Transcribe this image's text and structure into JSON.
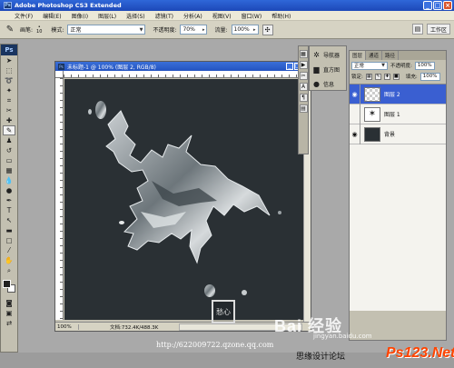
{
  "app": {
    "title": "Adobe Photoshop CS3 Extended",
    "logo": "Ps"
  },
  "menu": [
    "文件(F)",
    "编辑(E)",
    "图像(I)",
    "图层(L)",
    "选择(S)",
    "滤镜(T)",
    "分析(A)",
    "视图(V)",
    "窗口(W)",
    "帮助(H)"
  ],
  "options": {
    "brush_label": "画笔:",
    "brush_size": "10",
    "mode_label": "模式:",
    "mode_value": "正常",
    "opacity_label": "不透明度:",
    "opacity_value": "70%",
    "flow_label": "流量:",
    "flow_value": "100%",
    "workspace_label": "工作区"
  },
  "document": {
    "title": "未标题-1 @ 100% (图层 2, RGB/8)",
    "zoom": "100%",
    "doc_size": "文档:732.4K/488.3K",
    "canvas_color": "#2a3034"
  },
  "dock": {
    "items": [
      {
        "icon": "navigator-icon",
        "label": "导航器"
      },
      {
        "icon": "histogram-icon",
        "label": "直方图"
      },
      {
        "icon": "info-icon",
        "label": "信息"
      }
    ]
  },
  "layers_panel": {
    "tabs": [
      "图层",
      "通道",
      "路径"
    ],
    "blend_mode": "正常",
    "opacity_label": "不透明度:",
    "opacity_value": "100%",
    "lock_label": "锁定:",
    "fill_label": "填充:",
    "fill_value": "100%",
    "layers": [
      {
        "name": "图层 2",
        "selected": true,
        "thumb": "transparent"
      },
      {
        "name": "图层 1",
        "selected": false,
        "thumb": "white"
      },
      {
        "name": "背景",
        "selected": false,
        "thumb": "dark"
      }
    ]
  },
  "watermarks": {
    "url": "http://622009722.qzone.qq.com",
    "forum": "思缘设计论坛",
    "baidu": "Bai 经验",
    "jingyan": "jingyan.baidu.com",
    "ps123": "Ps123.Net",
    "seal": "愁心"
  },
  "colors": {
    "title_blue": "#2353c0",
    "selected_layer": "#3a5fd1",
    "workspace_gray": "#a9a9a9"
  }
}
